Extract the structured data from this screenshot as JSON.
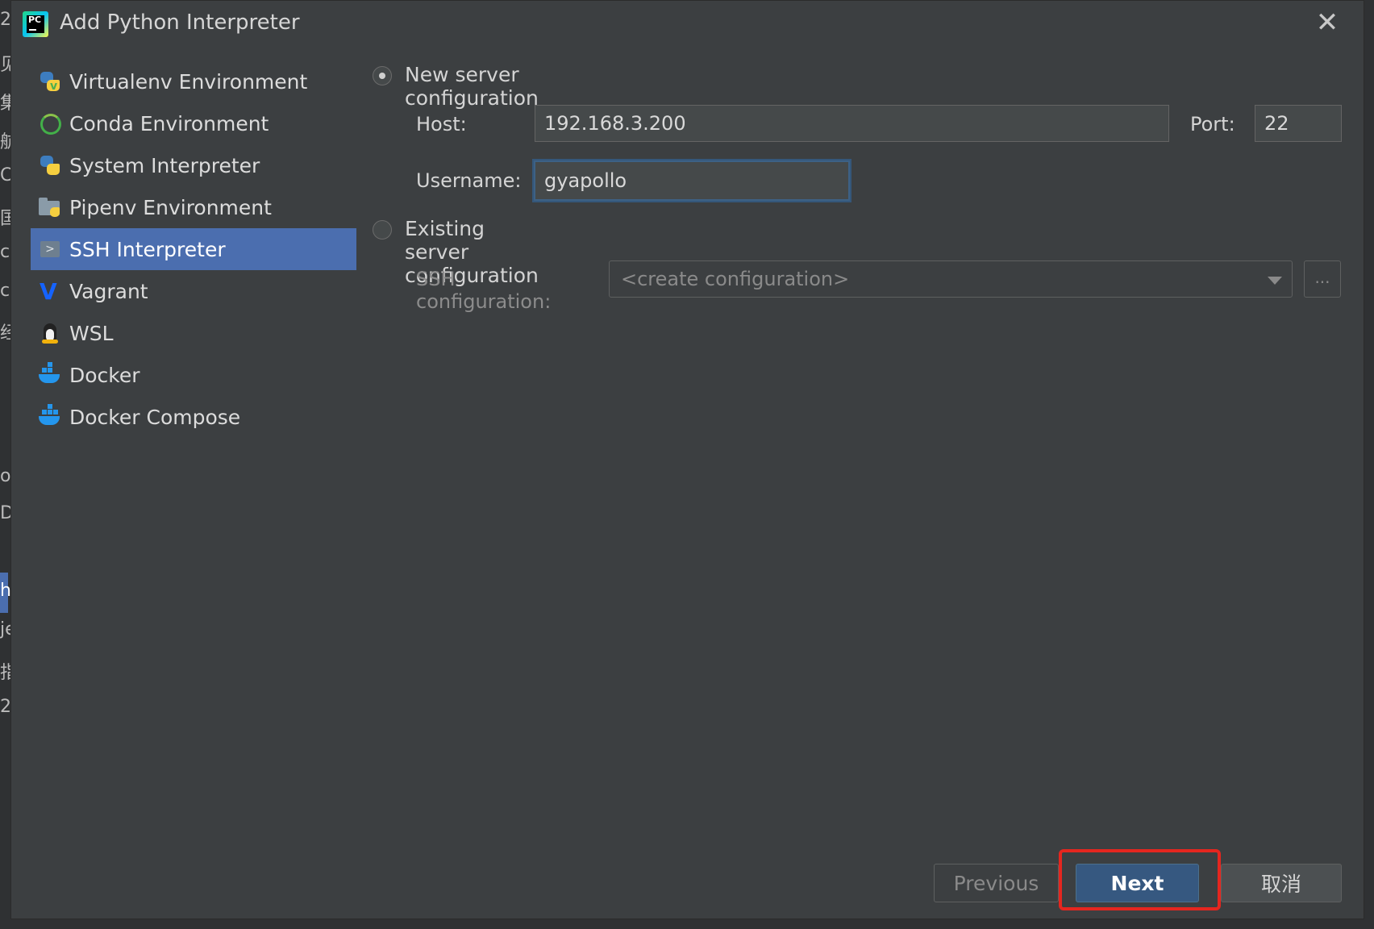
{
  "window": {
    "title": "Add Python Interpreter",
    "app_icon_text": "PC"
  },
  "sidebar": {
    "items": [
      {
        "label": "Virtualenv Environment",
        "icon": "python-virtualenv-icon"
      },
      {
        "label": "Conda Environment",
        "icon": "conda-icon"
      },
      {
        "label": "System Interpreter",
        "icon": "python-icon"
      },
      {
        "label": "Pipenv Environment",
        "icon": "pipenv-folder-icon"
      },
      {
        "label": "SSH Interpreter",
        "icon": "ssh-terminal-icon",
        "selected": true
      },
      {
        "label": "Vagrant",
        "icon": "vagrant-icon"
      },
      {
        "label": "WSL",
        "icon": "linux-penguin-icon"
      },
      {
        "label": "Docker",
        "icon": "docker-icon"
      },
      {
        "label": "Docker Compose",
        "icon": "docker-compose-icon"
      }
    ]
  },
  "new_server": {
    "label": "New server configuration",
    "selected": true,
    "host_label": "Host:",
    "host_value": "192.168.3.200",
    "port_label": "Port:",
    "port_value": "22",
    "username_label": "Username:",
    "username_value": "gyapollo"
  },
  "existing_server": {
    "label": "Existing server configuration",
    "selected": false,
    "ssh_config_label": "SSH configuration:",
    "ssh_config_value": "<create configuration>",
    "browse_label": "..."
  },
  "buttons": {
    "previous": "Previous",
    "next": "Next",
    "cancel": "取消"
  },
  "background_glyphs": [
    "2",
    "见",
    "集",
    "航",
    "C",
    "国",
    "ci",
    "c",
    "经",
    "or",
    "Do",
    "h",
    "je",
    "指",
    "2"
  ],
  "colors": {
    "dialog_bg": "#3c3f41",
    "selection": "#4b6eaf",
    "primary_button": "#365880",
    "highlight_box": "#e5261f"
  }
}
